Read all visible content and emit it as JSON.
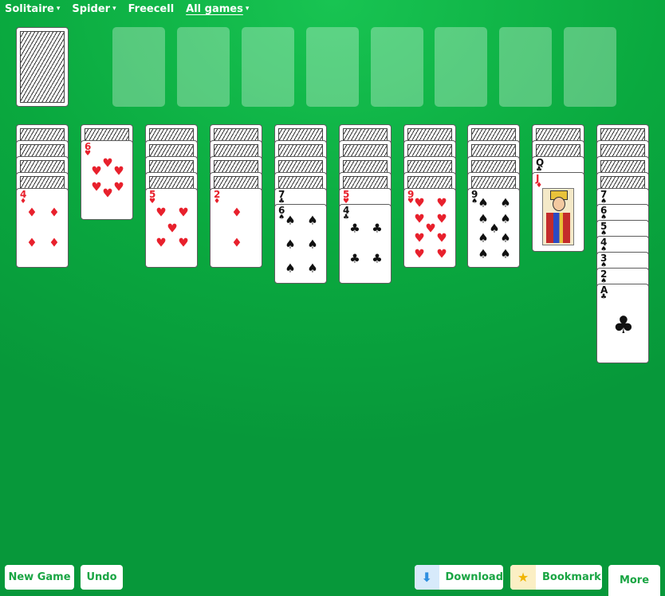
{
  "nav": [
    {
      "label": "Solitaire",
      "caret": "▾",
      "active": false
    },
    {
      "label": "Spider",
      "caret": "▾",
      "active": false
    },
    {
      "label": "Freecell",
      "caret": "",
      "active": false
    },
    {
      "label": "All games",
      "caret": "▾",
      "active": true
    }
  ],
  "stock": {
    "remaining": "face-down"
  },
  "foundations": [
    {},
    {},
    {},
    {},
    {},
    {},
    {},
    {}
  ],
  "tableau": [
    {
      "down": 4,
      "up": [
        {
          "rank": "4",
          "suit": "♦",
          "color": "red"
        }
      ]
    },
    {
      "down": 1,
      "up": [
        {
          "rank": "6",
          "suit": "♥",
          "color": "red"
        }
      ]
    },
    {
      "down": 4,
      "up": [
        {
          "rank": "5",
          "suit": "♥",
          "color": "red"
        }
      ]
    },
    {
      "down": 4,
      "up": [
        {
          "rank": "2",
          "suit": "♦",
          "color": "red"
        }
      ]
    },
    {
      "down": 4,
      "up": [
        {
          "rank": "7",
          "suit": "♣",
          "color": "black"
        },
        {
          "rank": "6",
          "suit": "♠",
          "color": "black"
        }
      ]
    },
    {
      "down": 4,
      "up": [
        {
          "rank": "5",
          "suit": "♥",
          "color": "red"
        },
        {
          "rank": "4",
          "suit": "♣",
          "color": "black"
        }
      ]
    },
    {
      "down": 4,
      "up": [
        {
          "rank": "9",
          "suit": "♥",
          "color": "red"
        }
      ]
    },
    {
      "down": 4,
      "up": [
        {
          "rank": "9",
          "suit": "♠",
          "color": "black"
        }
      ]
    },
    {
      "down": 2,
      "up": [
        {
          "rank": "Q",
          "suit": "♣",
          "color": "black"
        },
        {
          "rank": "J",
          "suit": "♦",
          "color": "red",
          "face": true
        }
      ]
    },
    {
      "down": 4,
      "up": [
        {
          "rank": "7",
          "suit": "♠",
          "color": "black"
        },
        {
          "rank": "6",
          "suit": "♠",
          "color": "black"
        },
        {
          "rank": "5",
          "suit": "♠",
          "color": "black"
        },
        {
          "rank": "4",
          "suit": "♠",
          "color": "black"
        },
        {
          "rank": "3",
          "suit": "♠",
          "color": "black"
        },
        {
          "rank": "2",
          "suit": "♠",
          "color": "black"
        },
        {
          "rank": "A",
          "suit": "♣",
          "color": "black"
        }
      ]
    }
  ],
  "buttons": {
    "new_game": "New Game",
    "undo": "Undo",
    "download": "Download",
    "download_icon": "download-arrow-icon",
    "bookmark": "Bookmark",
    "bookmark_icon": "star-icon",
    "more": "More"
  },
  "colors": {
    "felt": "#0aa93f",
    "button_text": "#19a543",
    "red_suit": "#e8202c",
    "download_icon_bg": "#d7eafb",
    "bookmark_icon_bg": "#fbefc4"
  }
}
